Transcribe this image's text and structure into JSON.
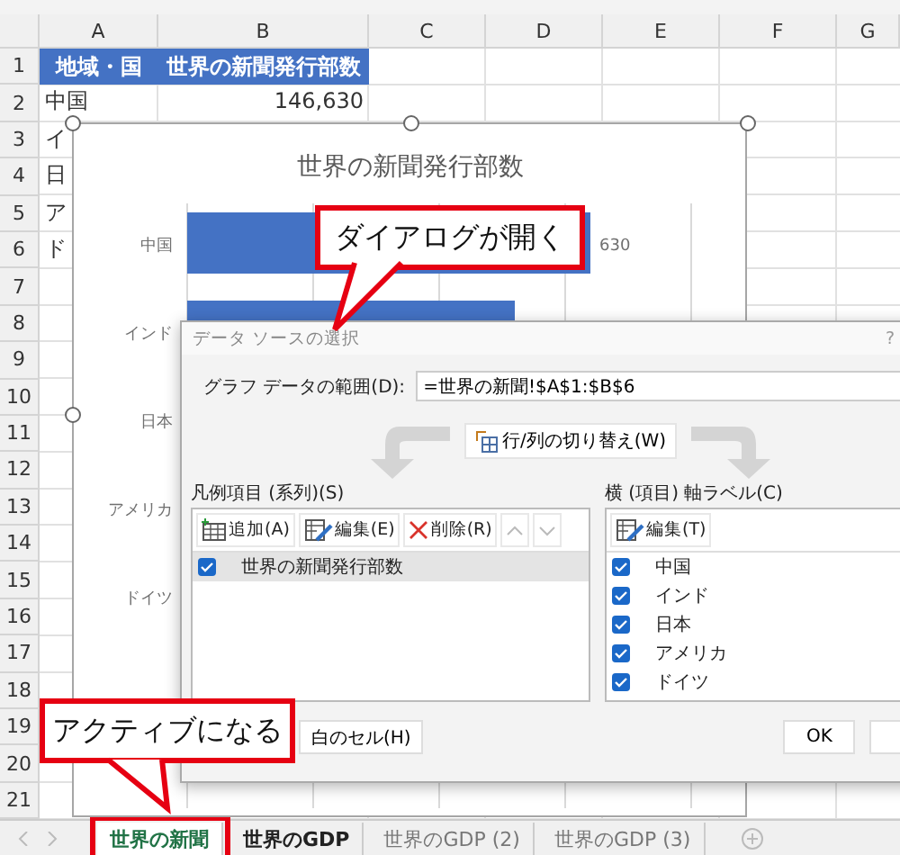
{
  "sheet": {
    "columns": [
      "A",
      "B",
      "C",
      "D",
      "E",
      "F",
      "G"
    ],
    "rows": [
      {
        "label": "1",
        "cells": [
          {
            "text": "地域・国",
            "kind": "header"
          },
          {
            "text": "世界の新聞発行部数",
            "kind": "header"
          }
        ]
      },
      {
        "label": "2",
        "cells": [
          {
            "text": "中国",
            "kind": "text"
          },
          {
            "text": "146,630",
            "kind": "number"
          }
        ]
      },
      {
        "label": "3",
        "cells": [
          {
            "text": "イ",
            "kind": "text"
          }
        ]
      },
      {
        "label": "4",
        "cells": [
          {
            "text": "日",
            "kind": "text"
          }
        ]
      },
      {
        "label": "5",
        "cells": [
          {
            "text": "ア",
            "kind": "text"
          }
        ]
      },
      {
        "label": "6",
        "cells": [
          {
            "text": "ド",
            "kind": "text"
          }
        ]
      },
      {
        "label": "7"
      },
      {
        "label": "8"
      },
      {
        "label": "9"
      },
      {
        "label": "10"
      },
      {
        "label": "11"
      },
      {
        "label": "12"
      },
      {
        "label": "13"
      },
      {
        "label": "14"
      },
      {
        "label": "15"
      },
      {
        "label": "16"
      },
      {
        "label": "17"
      },
      {
        "label": "18"
      },
      {
        "label": "19"
      },
      {
        "label": "20"
      },
      {
        "label": "21"
      }
    ]
  },
  "chart": {
    "title": "世界の新聞発行部数",
    "categories": [
      {
        "label": "中国",
        "level": 0.8,
        "value_label": "630"
      },
      {
        "label": "インド",
        "level": 0.65
      },
      {
        "label": "日本"
      },
      {
        "label": "アメリカ"
      },
      {
        "label": "ドイツ"
      }
    ]
  },
  "dialog": {
    "title": "データ ソースの選択",
    "help": "?",
    "range_label": "グラフ データの範囲(D):",
    "range_value": "=世界の新聞!$A$1:$B$6",
    "switch_button": "行/列の切り替え(W)",
    "series_panel": {
      "label": "凡例項目 (系列)(S)",
      "buttons": [
        {
          "label": "追加(A)",
          "kind": "add",
          "disabled": false
        },
        {
          "label": "編集(E)",
          "kind": "edit",
          "disabled": false
        },
        {
          "label": "削除(R)",
          "kind": "delete",
          "disabled": false
        },
        {
          "kind": "up",
          "disabled": true
        },
        {
          "kind": "down",
          "disabled": true
        }
      ],
      "items": [
        {
          "label": "世界の新聞発行部数",
          "checked": true,
          "selected": true
        }
      ]
    },
    "axis_panel": {
      "label": "横 (項目) 軸ラベル(C)",
      "buttons": [
        {
          "label": "編集(T)",
          "kind": "edit",
          "disabled": false
        }
      ],
      "items": [
        {
          "label": "中国",
          "checked": true
        },
        {
          "label": "インド",
          "checked": true
        },
        {
          "label": "日本",
          "checked": true
        },
        {
          "label": "アメリカ",
          "checked": true
        },
        {
          "label": "ドイツ",
          "checked": true
        }
      ]
    },
    "footer_buttons": [
      {
        "label": "白のセル(H)"
      },
      {
        "label": "OK"
      },
      {
        "kind": "blank"
      }
    ]
  },
  "callouts": [
    {
      "text": "ダイアログが開く"
    },
    {
      "text": "アクティブになる"
    }
  ],
  "tabs": [
    {
      "label": "世界の新聞",
      "selected": true,
      "outlined": true
    },
    {
      "label": "世界のGDP",
      "selected": false,
      "outlined": false
    },
    {
      "label": "世界のGDP (2)",
      "selected": false,
      "outlined": false
    },
    {
      "label": "世界のGDP (3)",
      "selected": false,
      "outlined": false
    }
  ]
}
